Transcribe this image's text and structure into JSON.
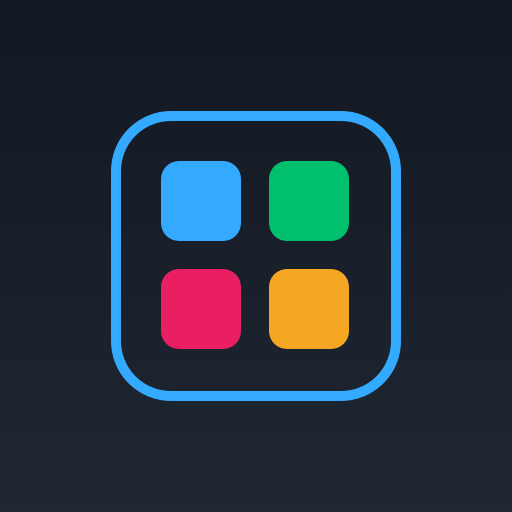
{
  "app_icon": {
    "name": "app-grid-icon",
    "background_top": "#121821",
    "background_bottom": "#1f2733",
    "frame_color": "#33aaff",
    "tiles": [
      {
        "name": "tile-blue",
        "color": "#33aaff"
      },
      {
        "name": "tile-green",
        "color": "#00c06e"
      },
      {
        "name": "tile-pink",
        "color": "#e91e63"
      },
      {
        "name": "tile-orange",
        "color": "#f5a623"
      }
    ]
  }
}
